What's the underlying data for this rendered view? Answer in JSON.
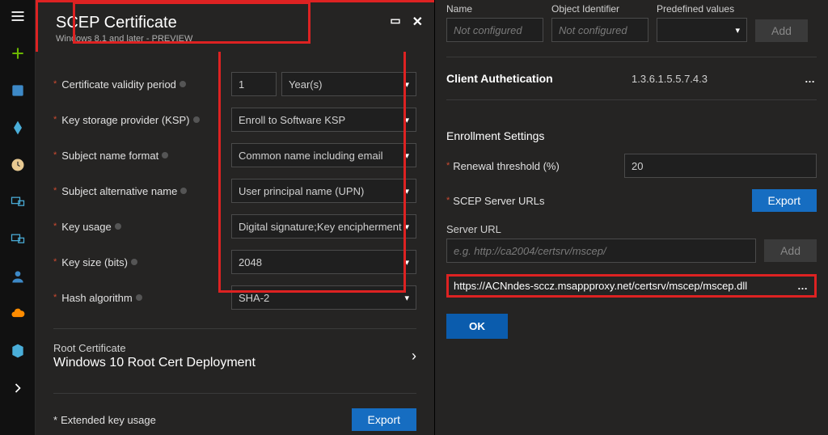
{
  "panel": {
    "title": "SCEP Certificate",
    "subtitle": "Windows 8.1 and later - PREVIEW"
  },
  "fields": {
    "validity_label": "Certificate validity period",
    "validity_value": "1",
    "validity_unit": "Year(s)",
    "ksp_label": "Key storage provider (KSP)",
    "ksp_value": "Enroll to Software KSP",
    "subject_label": "Subject name format",
    "subject_value": "Common name including email",
    "san_label": "Subject alternative name",
    "san_value": "User principal name (UPN)",
    "keyusage_label": "Key usage",
    "keyusage_value": "Digital signature;Key encipherment",
    "keysize_label": "Key size (bits)",
    "keysize_value": "2048",
    "hash_label": "Hash algorithm",
    "hash_value": "SHA-2"
  },
  "root": {
    "title": "Root Certificate",
    "value": "Windows 10 Root Cert Deployment"
  },
  "eku": {
    "label": "Extended key usage",
    "export": "Export"
  },
  "right": {
    "cols": {
      "name": "Name",
      "oid": "Object Identifier",
      "predefined": "Predefined values"
    },
    "not_configured": "Not configured",
    "add": "Add",
    "client_auth_name": "Client Authetication",
    "client_auth_oid": "1.3.6.1.5.5.7.4.3",
    "enroll_settings": "Enrollment Settings",
    "renewal_label": "Renewal threshold (%)",
    "renewal_value": "20",
    "scep_urls_label": "SCEP Server URLs",
    "export": "Export",
    "server_url_label": "Server URL",
    "server_url_placeholder": "e.g. http://ca2004/certsrv/mscep/",
    "url_entry": "https://ACNndes-sccz.msappproxy.net/certsrv/mscep/mscep.dll",
    "ok": "OK"
  }
}
